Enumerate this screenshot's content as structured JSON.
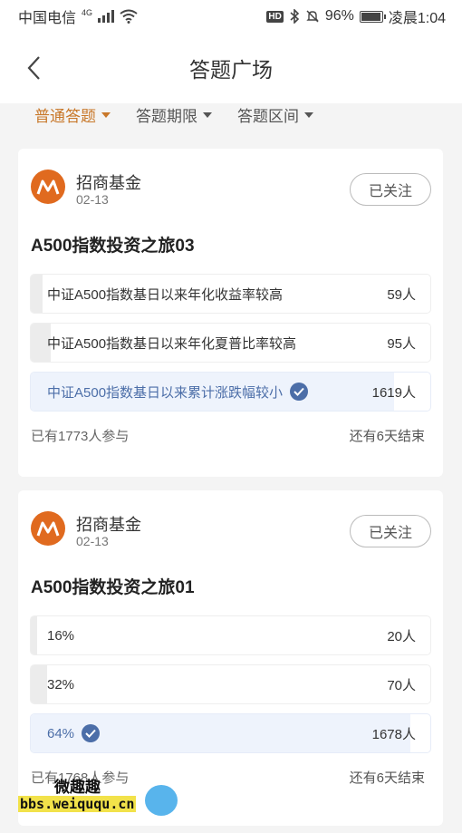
{
  "status": {
    "carrier": "中国电信",
    "network": "4G",
    "hd": "HD",
    "battery": "96%",
    "time": "凌晨1:04"
  },
  "nav": {
    "title": "答题广场"
  },
  "filters": [
    "普通答题",
    "答题期限",
    "答题区间"
  ],
  "cards": [
    {
      "org": "招商基金",
      "date": "02-13",
      "follow": "已关注",
      "title": "A500指数投资之旅03",
      "options": [
        {
          "label": "中证A500指数基日以来年化收益率较高",
          "count": "59人",
          "share": 0.03,
          "selected": false
        },
        {
          "label": "中证A500指数基日以来年化夏普比率较高",
          "count": "95人",
          "share": 0.05,
          "selected": false
        },
        {
          "label": "中证A500指数基日以来累计涨跌幅较小",
          "count": "1619人",
          "share": 0.91,
          "selected": true
        }
      ],
      "participants": "已有1773人参与",
      "remaining": "还有6天结束"
    },
    {
      "org": "招商基金",
      "date": "02-13",
      "follow": "已关注",
      "title": "A500指数投资之旅01",
      "options": [
        {
          "label": "16%",
          "count": "20人",
          "share": 0.01,
          "selected": false
        },
        {
          "label": "32%",
          "count": "70人",
          "share": 0.04,
          "selected": false
        },
        {
          "label": "64%",
          "count": "1678人",
          "share": 0.95,
          "selected": true
        }
      ],
      "participants": "已有1768人参与",
      "remaining": "还有6天结束"
    }
  ],
  "watermark": {
    "text": "微趣趣",
    "url": "bbs.weiququ.cn"
  },
  "colors": {
    "accent": "#c8782a",
    "brand_logo": "#e06a1f",
    "selected": "#4c6ea8"
  }
}
